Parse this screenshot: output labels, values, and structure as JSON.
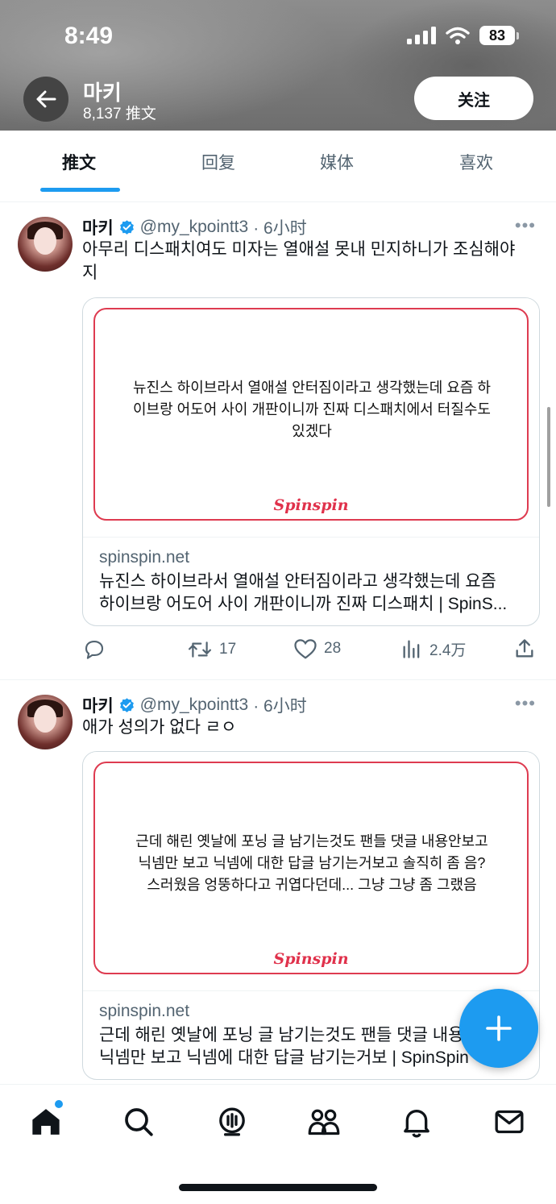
{
  "status_bar": {
    "time": "8:49",
    "battery": "83"
  },
  "profile": {
    "name": "마키",
    "post_count": "8,137 推文",
    "follow_label": "关注"
  },
  "tabs": [
    {
      "label": "推文",
      "active": true
    },
    {
      "label": "回复",
      "active": false
    },
    {
      "label": "媒体",
      "active": false
    },
    {
      "label": "喜欢",
      "active": false
    }
  ],
  "tweets": [
    {
      "author": "마키",
      "handle": "@my_kpointt3",
      "time": "· 6小时",
      "text_line1": "아무리 디스패치여도 미자는 열애설 못내 민지하니가 조심해야",
      "text_line2": "지",
      "card": {
        "quote_lines": [
          "뉴진스 하이브라서 열애설 안터짐이라고 생각했는데 요즘 하",
          "이브랑 어도어 사이 개판이니까 진짜 디스패치에서 터질수도",
          "있겠다"
        ],
        "brand": "Spinspin",
        "domain": "spinspin.net",
        "title_line1": "뉴진스 하이브라서 열애설 안터짐이라고 생각했는데 요즘",
        "title_line2": "하이브랑 어도어 사이 개판이니까 진짜 디스패치 | SpinS..."
      },
      "replies": "",
      "retweets": "17",
      "likes": "28",
      "views": "2.4万"
    },
    {
      "author": "마키",
      "handle": "@my_kpointt3",
      "time": "· 6小时",
      "text_line1": "애가 성의가 없다 ㄹㅇ",
      "card": {
        "quote_lines": [
          "근데 해린 옛날에 포닝 글 남기는것도 팬들 댓글 내용안보고",
          "닉넴만 보고 닉넴에 대한 답글 남기는거보고 솔직히 좀 음?",
          "스러웠음 엉뚱하다고 귀엽다던데... 그냥 그냥 좀 그랬음"
        ],
        "brand": "Spinspin",
        "domain": "spinspin.net",
        "title_line1": "근데 해린 옛날에 포닝 글 남기는것도 팬들 댓글 내용",
        "title_line2": "닉넴만 보고 닉넴에 대한 답글 남기는거보 | SpinSpin"
      }
    }
  ],
  "icons": {
    "back": "arrow-left-icon",
    "more": "more-dots-icon",
    "verified": "verified-badge-icon",
    "reply": "reply-icon",
    "retweet": "retweet-icon",
    "like": "heart-icon",
    "views": "views-icon",
    "share": "share-icon",
    "compose": "plus-icon",
    "home": "home-icon",
    "search": "search-icon",
    "spaces": "spaces-icon",
    "communities": "communities-icon",
    "notifications": "bell-icon",
    "messages": "mail-icon"
  },
  "colors": {
    "accent": "#1d9bf0",
    "card_border": "#de3b50",
    "brand": "#e0314b",
    "text": "#0f1419",
    "muted": "#536471"
  }
}
